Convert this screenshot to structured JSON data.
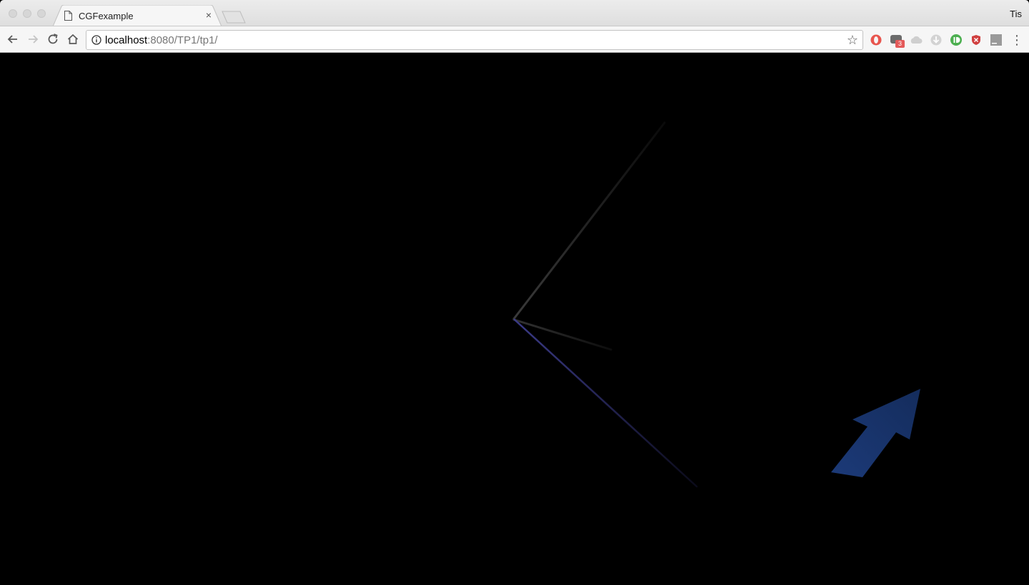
{
  "browser": {
    "profile_name": "Tis",
    "tab": {
      "title": "CGFexample",
      "close_glyph": "×"
    },
    "omnibox": {
      "host": "localhost",
      "rest": ":8080/TP1/tp1/"
    },
    "extensions": [
      {
        "name": "opera-icon",
        "color": "#e8554e"
      },
      {
        "name": "messages-icon",
        "color": "#6b6b6b",
        "badge": "3"
      },
      {
        "name": "cloud-icon",
        "color": "#c8c8c8"
      },
      {
        "name": "download-icon",
        "color": "#c8c8c8"
      },
      {
        "name": "pushbullet-icon",
        "color": "#4caf50"
      },
      {
        "name": "shield-icon",
        "color": "#d04040"
      },
      {
        "name": "jb-icon",
        "color": "#9a9a9a",
        "label": "JB"
      }
    ]
  },
  "scene": {
    "background": "#000000",
    "arrow_color": "#1a3366",
    "lines": [
      {
        "name": "line-gray-upper",
        "color": "#3c3c3c"
      },
      {
        "name": "line-gray-short",
        "color": "#2e2e2e"
      },
      {
        "name": "line-blue-lower",
        "color": "#3a3a7a"
      }
    ]
  }
}
